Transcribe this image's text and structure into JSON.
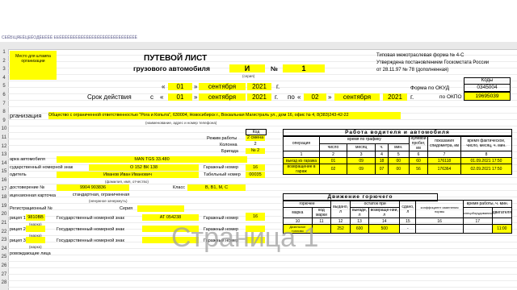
{
  "toolbar": {
    "ruler_text": "СЕЁБ\\ЦЯЕЁЦЕЁОДЁЕЁЁЁ ЕЕЁЁЁЁЁЁЁЁЁЁЁЁЁЁЁЁЁЁЁЁЁЁЁЁЁЁЁЁЁ"
  },
  "rows": [
    "1",
    "2",
    "3",
    "4",
    "5",
    "6",
    "7",
    "8",
    "9",
    "10",
    "11",
    "12",
    "13",
    "14",
    "15",
    "16",
    "17",
    "18",
    "19",
    "20",
    "21",
    "22",
    "23",
    "24",
    "25",
    "26",
    "27",
    "28"
  ],
  "header": {
    "stamp_place": "Место для штампа организации",
    "title": "ПУТЕВОЙ ЛИСТ",
    "subtitle": "грузового автомобиля",
    "series_value": "И",
    "series_caption": "(серия)",
    "number_sign": "№",
    "number_value": "1",
    "form_line1": "Типовая межотраслевая форма № 4-С",
    "form_line2": "Утверждена постановлением Госкомстата России",
    "form_line3": "от 28.11.97 № 78    (дополненная)",
    "codes_label": "Коды",
    "okud_label": "Форма по ОКУД",
    "okud_value": "0345004",
    "okpo_label": "по ОКПО",
    "okpo_value": "19695039"
  },
  "dates": {
    "row1_quote_open": "«",
    "row1_day": "01",
    "row1_quote_close": "»",
    "row1_month": "сентября",
    "row1_year": "2021",
    "row1_g": "г.",
    "validity_label": "Срок действия",
    "from_label": "с",
    "from_day": "01",
    "from_month": "сентября",
    "from_year": "2021",
    "to_label": "по",
    "to_day": "02",
    "to_month": "сентября",
    "to_year": "2021",
    "g": "г."
  },
  "org": {
    "label": "рганизация",
    "value": "Общество с ограниченной ответственностью \"Рога и Копыта\", 630004, Новосибирск г., Вокзальная Магистраль ул., дом 16, офис № 4, 8(383)243-42-22",
    "caption": "(наименование, адрес и номер телефона)"
  },
  "work": {
    "code_label": "Код",
    "mode_label": "Режим работы",
    "mode_value": "2 смена",
    "column_label": "Колонна",
    "column_value": "2",
    "brigade_label": "Бригада",
    "brigade_value": "№ 2"
  },
  "vehicle": {
    "brand_label": "арка автомобиля",
    "brand_value": "MAN TGS 33.480",
    "plate_label": "сударственный номерной знак",
    "plate_value": "О 152 ВК 138",
    "garage_label": "Гаражный номер",
    "garage_value": "16",
    "driver_label": "одитель",
    "driver_value": "Иванов Иван Иванович",
    "tabel_label": "Табельный номер",
    "tabel_value": "00035",
    "driver_caption": "(фамилия, имя, отчество)",
    "license_label": "достоверение №",
    "license_value": "9904 903836",
    "class_label": "Класс",
    "class_value": "B, B1, M, C",
    "card_label": "ицензионная карточка",
    "card_value": "стандартная, ограниченная",
    "card_caption": "(ненужное зачеркнуть)",
    "reg_label": "Регистрационный №",
    "series_label": "Серия",
    "series_value": "",
    "trailer1_label": "рицеп 1",
    "trailer1_value": "9810ВВ",
    "trailer1_plate_label": "Государственный номерной знак",
    "trailer1_plate_value": "АТ 054238",
    "trailer1_garage_label": "Гаражный номер",
    "trailer1_garage_value": "16",
    "trailer2_label": "рицеп 2",
    "trailer2_plate_label": "Государственный номерной знак",
    "trailer2_garage_label": "Гаражный номер",
    "trailer3_label": "рицеп 3",
    "trailer3_plate_label": "Государственный номерной знак",
    "trailer3_garage_label": "Гаражный номер",
    "brand_caption": "(марка)",
    "accompany_label": "ровождающие лица"
  },
  "driver_work": {
    "title": "Работа водителя и автомобиля",
    "headers": [
      "операция",
      "время по графику",
      "",
      "",
      "",
      "нулевой пробег, км",
      "показания спидометра, км",
      "время фактическое, число, месяц, ч. мин."
    ],
    "sub": [
      "",
      "число",
      "месяц",
      "ч.",
      "мин.",
      "",
      "",
      ""
    ],
    "nums": [
      "1",
      "2",
      "3",
      "4",
      "5",
      "6",
      "7",
      "8"
    ],
    "rows": [
      [
        "выезд из гаража",
        "01",
        "09",
        "18",
        "00",
        "60",
        "176118",
        "01.09.2021  17:50"
      ],
      [
        "возвращение в гараж",
        "02",
        "09",
        "07",
        "00",
        "56",
        "176364",
        "02.09.2021  17:50"
      ]
    ]
  },
  "fuel": {
    "title": "Движение горючего",
    "headers": [
      "горючее",
      "",
      "выдано, л",
      "остаток при",
      "",
      "сдано, л",
      "коэффициент изменения нормы",
      "время работы, ч. мин."
    ],
    "sub": [
      "марка",
      "код марки",
      "",
      "выезде, л",
      "возвраще-нии, л",
      "",
      "",
      "спецоборудования",
      "двигателя"
    ],
    "nums": [
      "10",
      "11",
      "12",
      "13",
      "14",
      "15",
      "16",
      "17"
    ],
    "row": [
      "Дизельное топливо",
      "",
      "252",
      "600",
      "500",
      "-",
      "",
      "",
      "11:00"
    ]
  },
  "watermark": "Страница 1"
}
